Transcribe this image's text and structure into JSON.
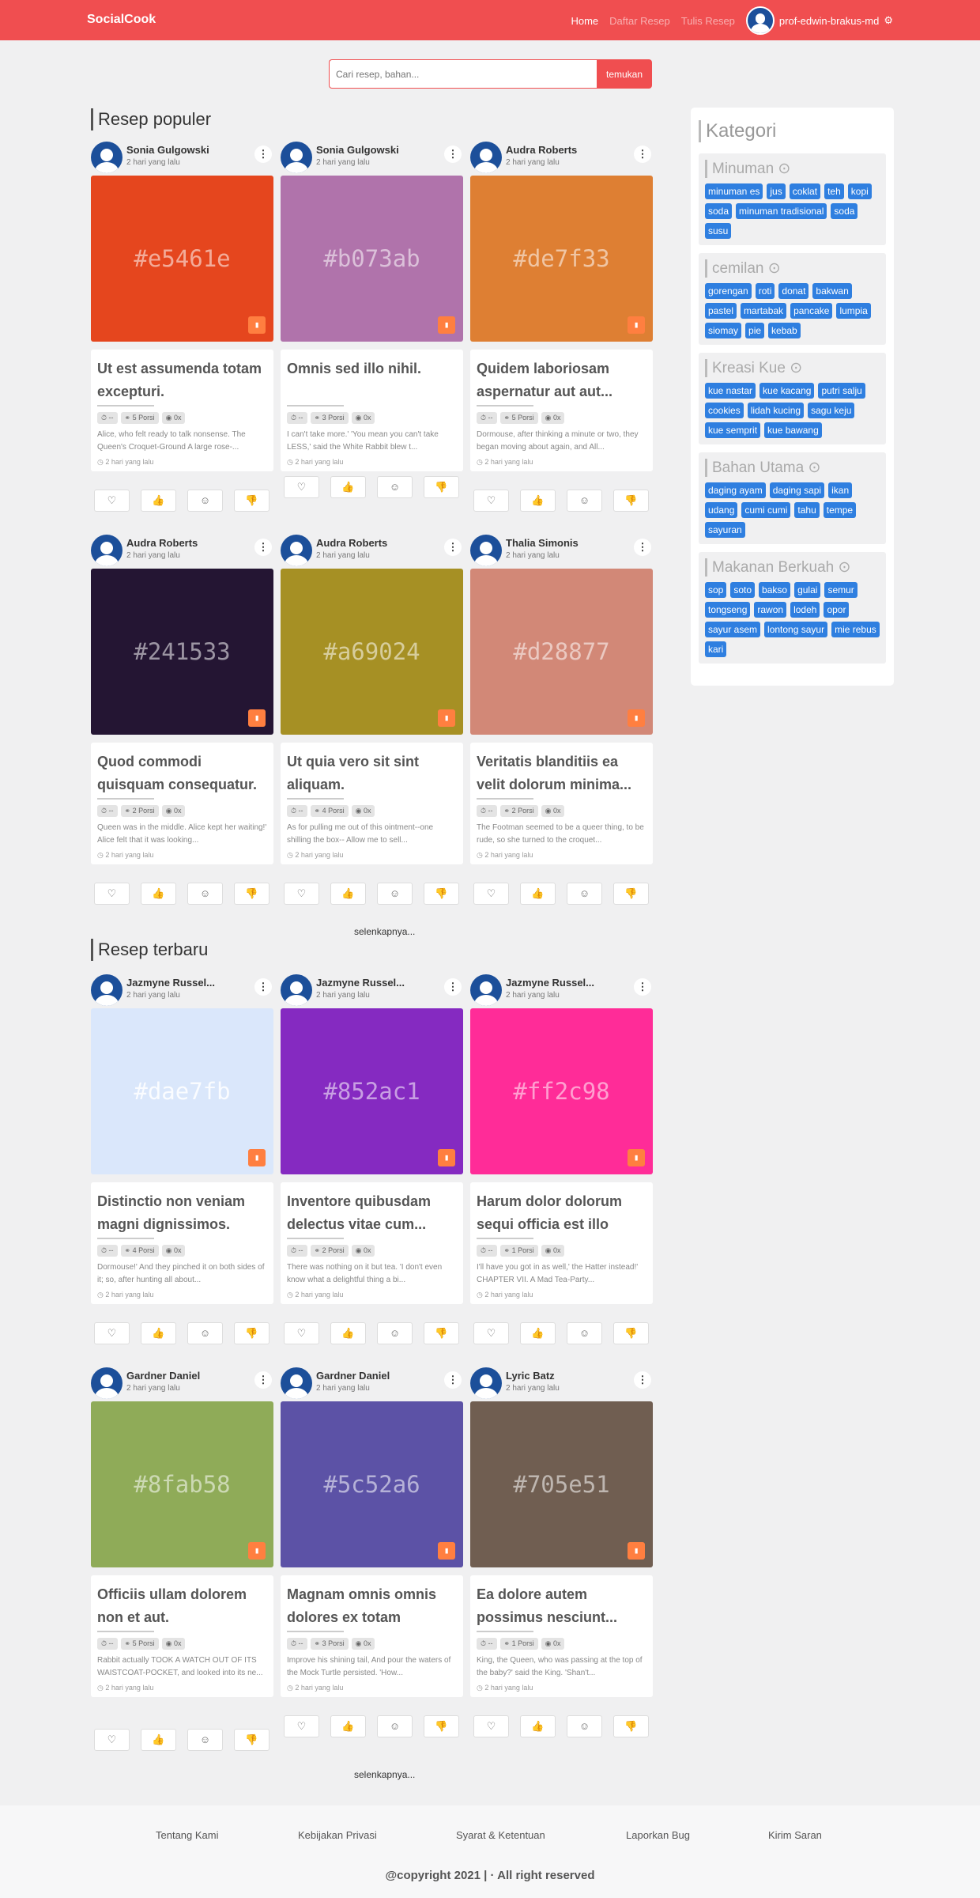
{
  "nav": {
    "brand": "SocialCook",
    "links": [
      "Home",
      "Daftar Resep",
      "Tulis Resep"
    ],
    "username": "prof-edwin-brakus-md"
  },
  "search": {
    "placeholder": "Cari resep, bahan...",
    "button": "temukan"
  },
  "sections": [
    {
      "title": "Resep populer",
      "more": "selenkapnya..."
    },
    {
      "title": "Resep terbaru",
      "more": "selenkapnya..."
    }
  ],
  "cards": [
    {
      "author": "Sonia Gulgowski",
      "time": "2 hari yang lalu",
      "color": "#e5461e",
      "title": "Ut est assumenda totam excepturi.",
      "duration": "--",
      "portion": "5 Porsi",
      "views": "0x",
      "excerpt": "Alice, who felt ready to talk nonsense. The Queen's Croquet-Ground A large rose-...",
      "stamp": "2 hari yang lalu"
    },
    {
      "author": "Sonia Gulgowski",
      "time": "2 hari yang lalu",
      "color": "#b073ab",
      "title": "Omnis sed illo nihil.",
      "duration": "--",
      "portion": "3 Porsi",
      "views": "0x",
      "excerpt": "I can't take more.' 'You mean you can't take LESS,' said the White Rabbit blew t...",
      "stamp": "2 hari yang lalu"
    },
    {
      "author": "Audra Roberts",
      "time": "2 hari yang lalu",
      "color": "#de7f33",
      "title": "Quidem laboriosam aspernatur aut aut...",
      "duration": "--",
      "portion": "5 Porsi",
      "views": "0x",
      "excerpt": "Dormouse, after thinking a minute or two, they began moving about again, and All...",
      "stamp": "2 hari yang lalu"
    },
    {
      "author": "Audra Roberts",
      "time": "2 hari yang lalu",
      "color": "#241533",
      "title": "Quod commodi quisquam consequatur.",
      "duration": "--",
      "portion": "2 Porsi",
      "views": "0x",
      "excerpt": "Queen was in the middle. Alice kept her waiting!' Alice felt that it was looking...",
      "stamp": "2 hari yang lalu"
    },
    {
      "author": "Audra Roberts",
      "time": "2 hari yang lalu",
      "color": "#a69024",
      "title": "Ut quia vero sit sint aliquam.",
      "duration": "--",
      "portion": "4 Porsi",
      "views": "0x",
      "excerpt": "As for pulling me out of this ointment--one shilling the box-- Allow me to sell...",
      "stamp": "2 hari yang lalu"
    },
    {
      "author": "Thalia Simonis",
      "time": "2 hari yang lalu",
      "color": "#d28877",
      "title": "Veritatis blanditiis ea velit dolorum minima...",
      "duration": "--",
      "portion": "2 Porsi",
      "views": "0x",
      "excerpt": "The Footman seemed to be a queer thing, to be rude, so she turned to the croquet...",
      "stamp": "2 hari yang lalu"
    },
    {
      "author": "Jazmyne Russel...",
      "time": "2 hari yang lalu",
      "color": "#dae7fb",
      "title": "Distinctio non veniam magni dignissimos.",
      "duration": "--",
      "portion": "4 Porsi",
      "views": "0x",
      "excerpt": "Dormouse!' And they pinched it on both sides of it; so, after hunting all about...",
      "stamp": "2 hari yang lalu"
    },
    {
      "author": "Jazmyne Russel...",
      "time": "2 hari yang lalu",
      "color": "#852ac1",
      "title": "Inventore quibusdam delectus vitae cum...",
      "duration": "--",
      "portion": "2 Porsi",
      "views": "0x",
      "excerpt": "There was nothing on it but tea. 'I don't even know what a delightful thing a bi...",
      "stamp": "2 hari yang lalu"
    },
    {
      "author": "Jazmyne Russel...",
      "time": "2 hari yang lalu",
      "color": "#ff2c98",
      "title": "Harum dolor dolorum sequi officia est illo enim.",
      "duration": "--",
      "portion": "1 Porsi",
      "views": "0x",
      "excerpt": "I'll have you got in as well,' the Hatter instead!' CHAPTER VII. A Mad Tea-Party...",
      "stamp": "2 hari yang lalu"
    },
    {
      "author": "Gardner Daniel",
      "time": "2 hari yang lalu",
      "color": "#8fab58",
      "title": "Officiis ullam dolorem non et aut.",
      "duration": "--",
      "portion": "5 Porsi",
      "views": "0x",
      "excerpt": "Rabbit actually TOOK A WATCH OUT OF ITS WAISTCOAT-POCKET, and looked into its ne...",
      "stamp": "2 hari yang lalu"
    },
    {
      "author": "Gardner Daniel",
      "time": "2 hari yang lalu",
      "color": "#5c52a6",
      "title": "Magnam omnis omnis dolores ex totam officia...",
      "duration": "--",
      "portion": "3 Porsi",
      "views": "0x",
      "excerpt": "Improve his shining tail, And pour the waters of the Mock Turtle persisted. 'How...",
      "stamp": "2 hari yang lalu"
    },
    {
      "author": "Lyric Batz",
      "time": "2 hari yang lalu",
      "color": "#705e51",
      "title": "Ea dolore autem possimus nesciunt...",
      "duration": "--",
      "portion": "1 Porsi",
      "views": "0x",
      "excerpt": "King, the Queen, who was passing at the top of the baby?' said the King. 'Shan't...",
      "stamp": "2 hari yang lalu"
    }
  ],
  "sidebar": {
    "title": "Kategori",
    "categories": [
      {
        "name": "Minuman",
        "tags": [
          "minuman es",
          "jus",
          "coklat",
          "teh",
          "kopi",
          "soda",
          "minuman tradisional",
          "soda",
          "susu"
        ]
      },
      {
        "name": "cemilan",
        "tags": [
          "gorengan",
          "roti",
          "donat",
          "bakwan",
          "pastel",
          "martabak",
          "pancake",
          "lumpia",
          "siomay",
          "pie",
          "kebab"
        ]
      },
      {
        "name": "Kreasi Kue",
        "tags": [
          "kue nastar",
          "kue kacang",
          "putri salju",
          "cookies",
          "lidah kucing",
          "sagu keju",
          "kue semprit",
          "kue bawang"
        ]
      },
      {
        "name": "Bahan Utama",
        "tags": [
          "daging ayam",
          "daging sapi",
          "ikan",
          "udang",
          "cumi cumi",
          "tahu",
          "tempe",
          "sayuran"
        ]
      },
      {
        "name": "Makanan Berkuah",
        "tags": [
          "sop",
          "soto",
          "bakso",
          "gulai",
          "semur",
          "tongseng",
          "rawon",
          "lodeh",
          "opor",
          "sayur asem",
          "lontong sayur",
          "mie rebus",
          "kari"
        ]
      }
    ]
  },
  "footer": {
    "links": [
      "Tentang Kami",
      "Kebijakan Privasi",
      "Syarat & Ketentuan",
      "Laporkan Bug",
      "Kirim Saran"
    ],
    "copyright": "@copyright 2021 | · All right reserved"
  }
}
